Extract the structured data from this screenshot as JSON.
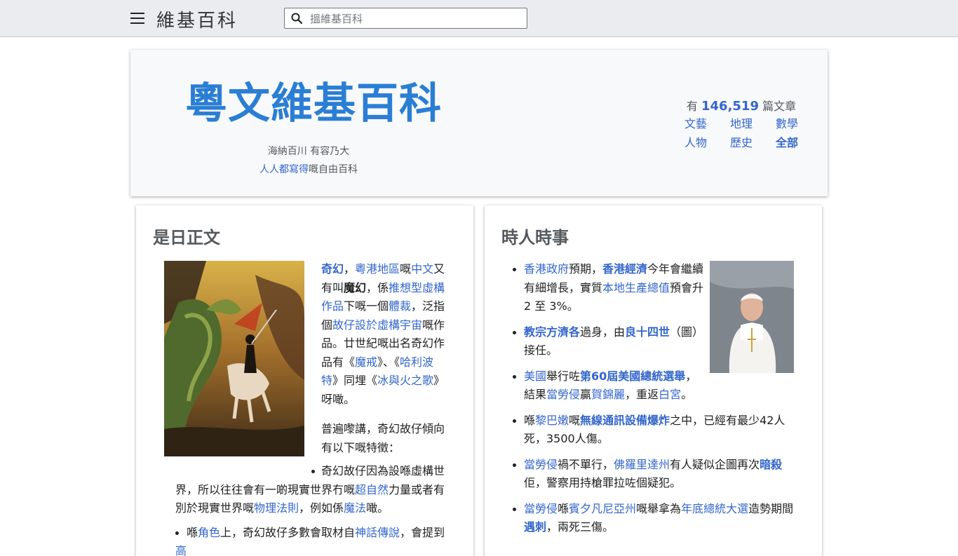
{
  "header": {
    "logo": "維基百科",
    "search_placeholder": "搵維基百科"
  },
  "banner": {
    "title": "粵文維基百科",
    "motto_line1": "海納百川 有容乃大",
    "motto_line2_link": "人人都寫得",
    "motto_line2_rest": "嘅自由百科",
    "stats_prefix": "有 ",
    "stats_count": "146,519",
    "stats_suffix": " 篇文章",
    "categories": [
      "文藝",
      "地理",
      "數學",
      "人物",
      "歷史",
      "全部"
    ]
  },
  "featured": {
    "heading": "是日正文",
    "image_alt": "painting of knight fighting dragon",
    "para1": [
      {
        "t": "奇幻",
        "link": true,
        "bold": true
      },
      {
        "t": "，",
        "link": false
      },
      {
        "t": "粵港地區",
        "link": true
      },
      {
        "t": "嘅",
        "link": false
      },
      {
        "t": "中文",
        "link": true
      },
      {
        "t": "又有叫",
        "link": false
      },
      {
        "t": "魔幻",
        "link": false,
        "bold": true
      },
      {
        "t": "，係",
        "link": false
      },
      {
        "t": "推想型虛構作品",
        "link": true
      },
      {
        "t": "下嘅一個",
        "link": false
      },
      {
        "t": "體裁",
        "link": true
      },
      {
        "t": "，泛指個",
        "link": false
      },
      {
        "t": "故仔設於虛構宇宙",
        "link": true
      },
      {
        "t": "嘅作品。廿世紀嘅出名奇幻作品有《",
        "link": false
      },
      {
        "t": "魔戒",
        "link": true
      },
      {
        "t": "》、《",
        "link": false
      },
      {
        "t": "哈利波特",
        "link": true
      },
      {
        "t": "》同埋《",
        "link": false
      },
      {
        "t": "冰與火之歌",
        "link": true
      },
      {
        "t": "》呀噉。",
        "link": false
      }
    ],
    "para2": "普遍嚟講，奇幻故仔傾向有以下嘅特徵：",
    "bullets": [
      [
        {
          "t": "奇幻故仔因為設喺虛構世界，所以往往會有一啲現實世界冇嘅",
          "link": false
        },
        {
          "t": "超自然",
          "link": true
        },
        {
          "t": "力量或者有別於現實世界嘅",
          "link": false
        },
        {
          "t": "物理法則",
          "link": true
        },
        {
          "t": "，例如係",
          "link": false
        },
        {
          "t": "魔法",
          "link": true
        },
        {
          "t": "噉。",
          "link": false
        }
      ],
      [
        {
          "t": "喺",
          "link": false
        },
        {
          "t": "角色",
          "link": true
        },
        {
          "t": "上，奇幻故仔多數會取材自",
          "link": false
        },
        {
          "t": "神話傳說",
          "link": true
        },
        {
          "t": "，會提到",
          "link": false
        },
        {
          "t": "高",
          "link": true
        }
      ]
    ]
  },
  "news": {
    "heading": "時人時事",
    "image_alt": "portrait of pope in white",
    "items": [
      [
        {
          "t": "香港政府",
          "link": true
        },
        {
          "t": "預期，",
          "link": false
        },
        {
          "t": "香港經濟",
          "link": true,
          "bold": true
        },
        {
          "t": "今年會繼續有細增長，實質",
          "link": false
        },
        {
          "t": "本地生產總值",
          "link": true
        },
        {
          "t": "預會升 2 至 3%。",
          "link": false
        }
      ],
      [
        {
          "t": "教宗方濟各",
          "link": true,
          "bold": true
        },
        {
          "t": "過身，由",
          "link": false
        },
        {
          "t": "良十四世",
          "link": true,
          "bold": true
        },
        {
          "t": "（圖）接任。",
          "link": false
        }
      ],
      [
        {
          "t": "美國",
          "link": true
        },
        {
          "t": "舉行咗",
          "link": false
        },
        {
          "t": "第60屆美國總統選舉",
          "link": true,
          "bold": true
        },
        {
          "t": "，結果",
          "link": false
        },
        {
          "t": "當勞侵",
          "link": true
        },
        {
          "t": "贏",
          "link": false
        },
        {
          "t": "賀錦麗",
          "link": true
        },
        {
          "t": "，重返",
          "link": false
        },
        {
          "t": "白宮",
          "link": true
        },
        {
          "t": "。",
          "link": false
        }
      ],
      [
        {
          "t": "喺",
          "link": false
        },
        {
          "t": "黎巴嫩",
          "link": true
        },
        {
          "t": "嘅",
          "link": false
        },
        {
          "t": "無線通訊設備爆炸",
          "link": true,
          "bold": true
        },
        {
          "t": "之中，已經有最少42人死，3500人傷。",
          "link": false
        }
      ],
      [
        {
          "t": "當勞侵",
          "link": true
        },
        {
          "t": "禍不單行，",
          "link": false
        },
        {
          "t": "佛羅里達州",
          "link": true
        },
        {
          "t": "有人疑似企圖再次",
          "link": false
        },
        {
          "t": "暗殺",
          "link": true,
          "bold": true
        },
        {
          "t": "佢，警察用持槍罪拉咗個疑犯。",
          "link": false
        }
      ],
      [
        {
          "t": "當勞侵",
          "link": true
        },
        {
          "t": "喺",
          "link": false
        },
        {
          "t": "賓夕凡尼亞州",
          "link": true
        },
        {
          "t": "嘅舉拿為",
          "link": false
        },
        {
          "t": "年底總統大選",
          "link": true
        },
        {
          "t": "造勢期間",
          "link": false
        },
        {
          "t": "遇刺",
          "link": true,
          "bold": true
        },
        {
          "t": "，兩死三傷。",
          "link": false
        }
      ]
    ]
  }
}
